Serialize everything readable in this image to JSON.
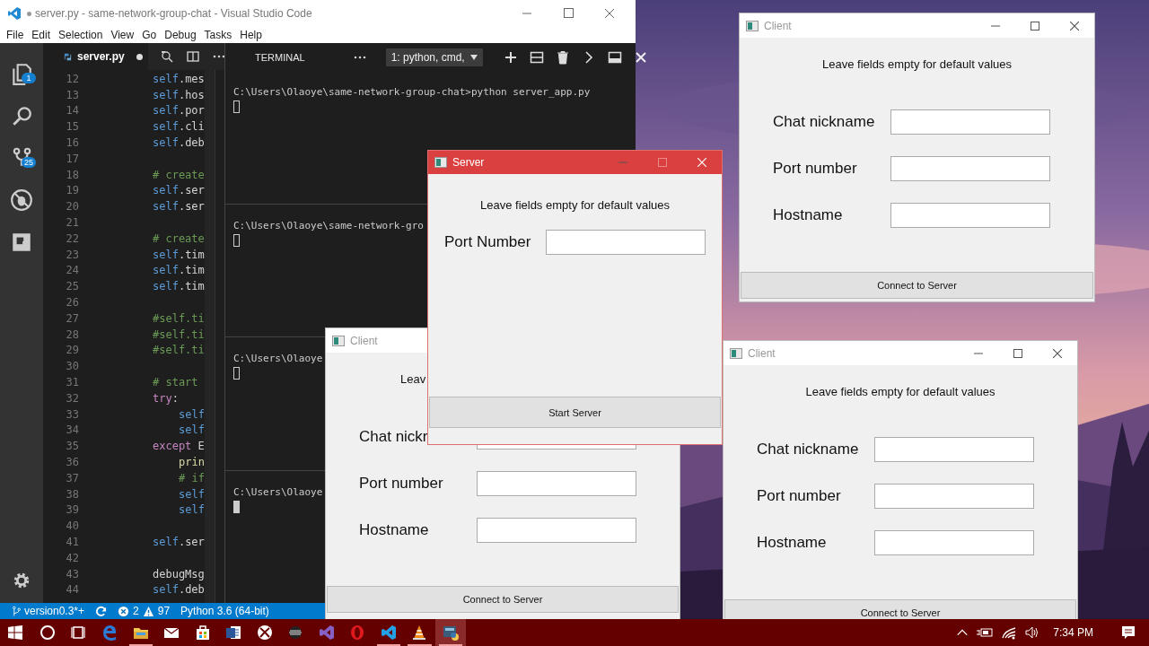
{
  "vscode": {
    "title": "server.py - same-network-group-chat - Visual Studio Code",
    "dirty": true,
    "menu": [
      "File",
      "Edit",
      "Selection",
      "View",
      "Go",
      "Debug",
      "Tasks",
      "Help"
    ],
    "activity": [
      {
        "kind": "files",
        "badge": "1"
      },
      {
        "kind": "search"
      },
      {
        "kind": "scm",
        "badge": "25"
      },
      {
        "kind": "debug"
      },
      {
        "kind": "extensions"
      }
    ],
    "tab": {
      "label": "server.py",
      "modified": true
    },
    "code": [
      {
        "n": "12",
        "kind": "self",
        "text": "self.mes"
      },
      {
        "n": "13",
        "kind": "self",
        "text": "self.hos"
      },
      {
        "n": "14",
        "kind": "self",
        "text": "self.por"
      },
      {
        "n": "15",
        "kind": "self",
        "text": "self.cli"
      },
      {
        "n": "16",
        "kind": "self",
        "text": "self.deb"
      },
      {
        "n": "17"
      },
      {
        "n": "18",
        "kind": "comment",
        "text": "# create"
      },
      {
        "n": "19",
        "kind": "self",
        "text": "self.ser"
      },
      {
        "n": "20",
        "kind": "self",
        "text": "self.ser"
      },
      {
        "n": "21"
      },
      {
        "n": "22",
        "kind": "comment",
        "text": "# create"
      },
      {
        "n": "23",
        "kind": "self",
        "text": "self.tim"
      },
      {
        "n": "24",
        "kind": "self",
        "text": "self.tim"
      },
      {
        "n": "25",
        "kind": "self",
        "text": "self.tim"
      },
      {
        "n": "26"
      },
      {
        "n": "27",
        "kind": "comment",
        "text": "#self.ti"
      },
      {
        "n": "28",
        "kind": "comment",
        "text": "#self.ti"
      },
      {
        "n": "29",
        "kind": "comment",
        "text": "#self.ti"
      },
      {
        "n": "30"
      },
      {
        "n": "31",
        "kind": "comment",
        "text": "# start"
      },
      {
        "n": "32",
        "kind": "keyword",
        "text": "try:"
      },
      {
        "n": "33",
        "kind": "self",
        "text": "self",
        "indented": true
      },
      {
        "n": "34",
        "kind": "self",
        "text": "self",
        "indented": true
      },
      {
        "n": "35",
        "kind": "keyword",
        "text": "except E"
      },
      {
        "n": "36",
        "kind": "call",
        "text": "prin",
        "indented": true
      },
      {
        "n": "37",
        "kind": "comment",
        "text": "# if",
        "indented": true
      },
      {
        "n": "38",
        "kind": "self",
        "text": "self",
        "indented": true
      },
      {
        "n": "39",
        "kind": "self",
        "text": "self",
        "indented": true
      },
      {
        "n": "40"
      },
      {
        "n": "41",
        "kind": "self",
        "text": "self.ser"
      },
      {
        "n": "42"
      },
      {
        "n": "43",
        "kind": "plain",
        "text": "debugMsg"
      },
      {
        "n": "44",
        "kind": "self",
        "text": "self.deb"
      }
    ],
    "panel": {
      "title": "TERMINAL",
      "terminal_select": "1: python, cmd,",
      "panes": [
        {
          "line": "C:\\Users\\Olaoye\\same-network-group-chat>python server_app.py",
          "focused": false
        },
        {
          "line": "C:\\Users\\Olaoye\\same-network-gro",
          "focused": false
        },
        {
          "line": "C:\\Users\\Olaoye",
          "focused": false
        },
        {
          "line": "C:\\Users\\Olaoye",
          "focused": true
        }
      ]
    },
    "status": {
      "branch": "version0.3*+",
      "errors": "2",
      "warnings": "97",
      "interpreter": "Python 3.6 (64-bit)"
    }
  },
  "windows": [
    {
      "kind": "client",
      "title": "Client",
      "active": false,
      "maximize": true,
      "hint": "Leave fields empty for default values",
      "fields": [
        {
          "label": "Chat nickname"
        },
        {
          "label": "Port number"
        },
        {
          "label": "Hostname"
        }
      ],
      "button": "Connect to Server"
    },
    {
      "kind": "client",
      "title": "Client",
      "active": false,
      "maximize": true,
      "hint": "Leave fields empty for default values",
      "fields": [
        {
          "label": "Chat nickname"
        },
        {
          "label": "Port number"
        },
        {
          "label": "Hostname"
        }
      ],
      "button": "Connect to Server"
    },
    {
      "kind": "client",
      "title": "Client",
      "active": false,
      "hint": "Leav",
      "fields": [
        {
          "label": "Chat nickr"
        },
        {
          "label": "Port number"
        },
        {
          "label": "Hostname"
        }
      ],
      "button": "Connect to Server"
    },
    {
      "kind": "server",
      "title": "Server",
      "active": true,
      "maximize": false,
      "hint": "Leave fields empty for default values",
      "fields": [
        {
          "label": "Port Number"
        }
      ],
      "button": "Start Server"
    }
  ],
  "taskbar": {
    "apps": [
      {
        "kind": "cortana",
        "running": false,
        "selected": false
      },
      {
        "kind": "taskview",
        "running": false,
        "selected": false
      },
      {
        "kind": "edge",
        "running": false,
        "selected": false
      },
      {
        "kind": "explorer",
        "running": true,
        "selected": false
      },
      {
        "kind": "mail",
        "running": false,
        "selected": false
      },
      {
        "kind": "store",
        "running": false,
        "selected": false
      },
      {
        "kind": "word",
        "running": false,
        "selected": false
      },
      {
        "kind": "xbox",
        "running": false,
        "selected": false
      },
      {
        "kind": "media",
        "running": false,
        "selected": false
      },
      {
        "kind": "vs",
        "running": false,
        "selected": false
      },
      {
        "kind": "opera",
        "running": false,
        "selected": false
      },
      {
        "kind": "vscode",
        "running": true,
        "selected": false
      },
      {
        "kind": "vlc",
        "running": true,
        "selected": false
      },
      {
        "kind": "pyapp",
        "running": true,
        "selected": true
      }
    ],
    "clock": "7:34 PM"
  }
}
